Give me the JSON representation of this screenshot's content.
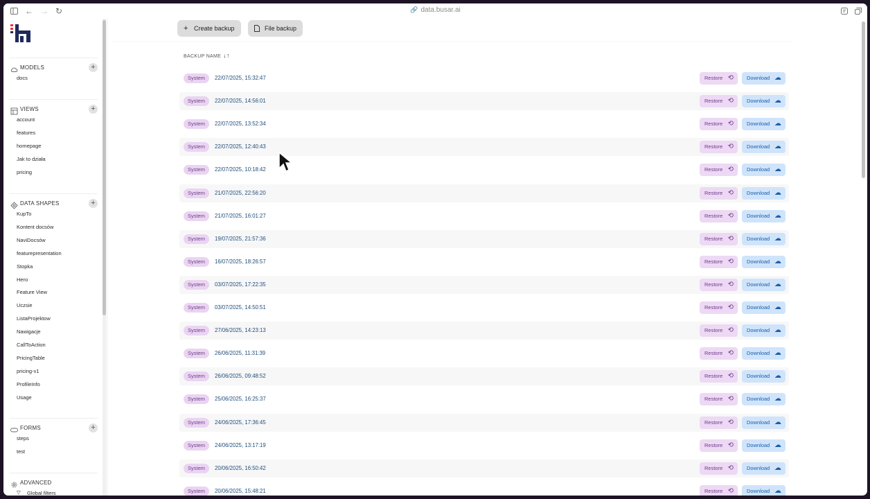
{
  "browser": {
    "url": "data.busar.ai"
  },
  "sidebar": {
    "sections": [
      {
        "title": "MODELS",
        "icon": "cloud-icon",
        "items": [
          "docs"
        ]
      },
      {
        "title": "VIEWS",
        "icon": "layout-icon",
        "items": [
          "account",
          "features",
          "homepage",
          "Jak to działa",
          "pricing"
        ]
      },
      {
        "title": "DATA SHAPES",
        "icon": "shapes-icon",
        "items": [
          "KupTo",
          "Kontent docsów",
          "NaviDocsów",
          "featurepresentation",
          "Stopka",
          "Hero",
          "Feature View",
          "Uczsie",
          "ListaProjektow",
          "Nawigacje",
          "CallToAction",
          "PricingTable",
          "pricing-v1",
          "ProfileInfo",
          "Usage"
        ]
      },
      {
        "title": "FORMS",
        "icon": "form-icon",
        "items": [
          "steps",
          "test"
        ]
      },
      {
        "title": "ADVANCED",
        "icon": "gear-icon",
        "items": [
          "Global filters"
        ]
      }
    ],
    "add_symbol": "+"
  },
  "toolbar": {
    "create_backup": "Create backup",
    "file_backup": "File backup"
  },
  "table": {
    "column_header": "BACKUP NAME",
    "sort_symbol": "↓↑",
    "badge_label": "System",
    "restore_label": "Restore",
    "download_label": "Download",
    "rows": [
      "22/07/2025, 15:32:47",
      "22/07/2025, 14:56:01",
      "22/07/2025, 13:52:34",
      "22/07/2025, 12:40:43",
      "22/07/2025, 10:18:42",
      "21/07/2025, 22:56:20",
      "21/07/2025, 16:01:27",
      "19/07/2025, 21:57:36",
      "16/07/2025, 18:26:57",
      "03/07/2025, 17:22:35",
      "03/07/2025, 14:50:51",
      "27/06/2025, 14:23:13",
      "26/06/2025, 11:31:39",
      "26/06/2025, 09:48:52",
      "25/06/2025, 16:25:37",
      "24/06/2025, 17:36:45",
      "24/06/2025, 13:17:19",
      "20/06/2025, 16:50:42",
      "20/06/2025, 15:48:21"
    ]
  },
  "colors": {
    "badge_bg": "#ead4f2",
    "restore_bg": "#edd9f4",
    "download_bg": "#cfe4fb",
    "date_text": "#1f4d7a"
  }
}
